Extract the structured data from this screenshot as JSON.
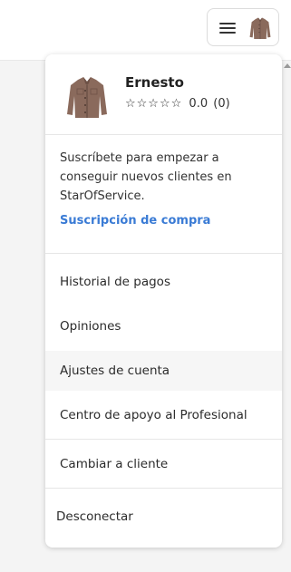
{
  "header": {
    "menu_icon": "hamburger-icon",
    "avatar": "jacket-avatar"
  },
  "profile": {
    "name": "Ernesto",
    "stars": "☆☆☆☆☆",
    "rating_value": "0.0",
    "rating_count": "(0)",
    "avatar": "jacket-avatar"
  },
  "subscribe": {
    "text": "Suscríbete para empezar a conseguir nuevos clientes en StarOfService.",
    "link_label": "Suscripción de compra",
    "link_color": "#3a7bd5"
  },
  "menu": {
    "payment_history": "Historial de pagos",
    "reviews": "Opiniones",
    "account_settings": "Ajustes de cuenta",
    "support_center": "Centro de apoyo al Profesional",
    "switch_to_client": "Cambiar a cliente",
    "logout": "Desconectar"
  }
}
